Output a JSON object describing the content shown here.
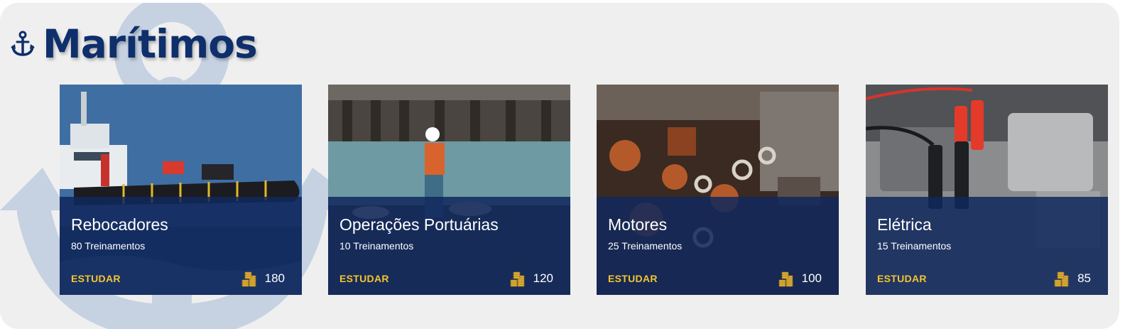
{
  "section": {
    "title": "Marítimos",
    "icon": "anchor-icon"
  },
  "colors": {
    "title": "#0e2f6b",
    "overlay": "#10285c",
    "study": "#f5c431",
    "panel": "#efefef"
  },
  "cards": [
    {
      "name": "Rebocadores",
      "count": "80 Treinamentos",
      "action": "ESTUDAR",
      "coins": "180",
      "image": "tugboat-photo"
    },
    {
      "name": "Operações Portuárias",
      "count": "10 Treinamentos",
      "action": "ESTUDAR",
      "coins": "120",
      "image": "port-worker-photo"
    },
    {
      "name": "Motores",
      "count": "25 Treinamentos",
      "action": "ESTUDAR",
      "coins": "100",
      "image": "engine-photo"
    },
    {
      "name": "Elétrica",
      "count": "15 Treinamentos",
      "action": "ESTUDAR",
      "coins": "85",
      "image": "jumper-cables-photo"
    }
  ]
}
